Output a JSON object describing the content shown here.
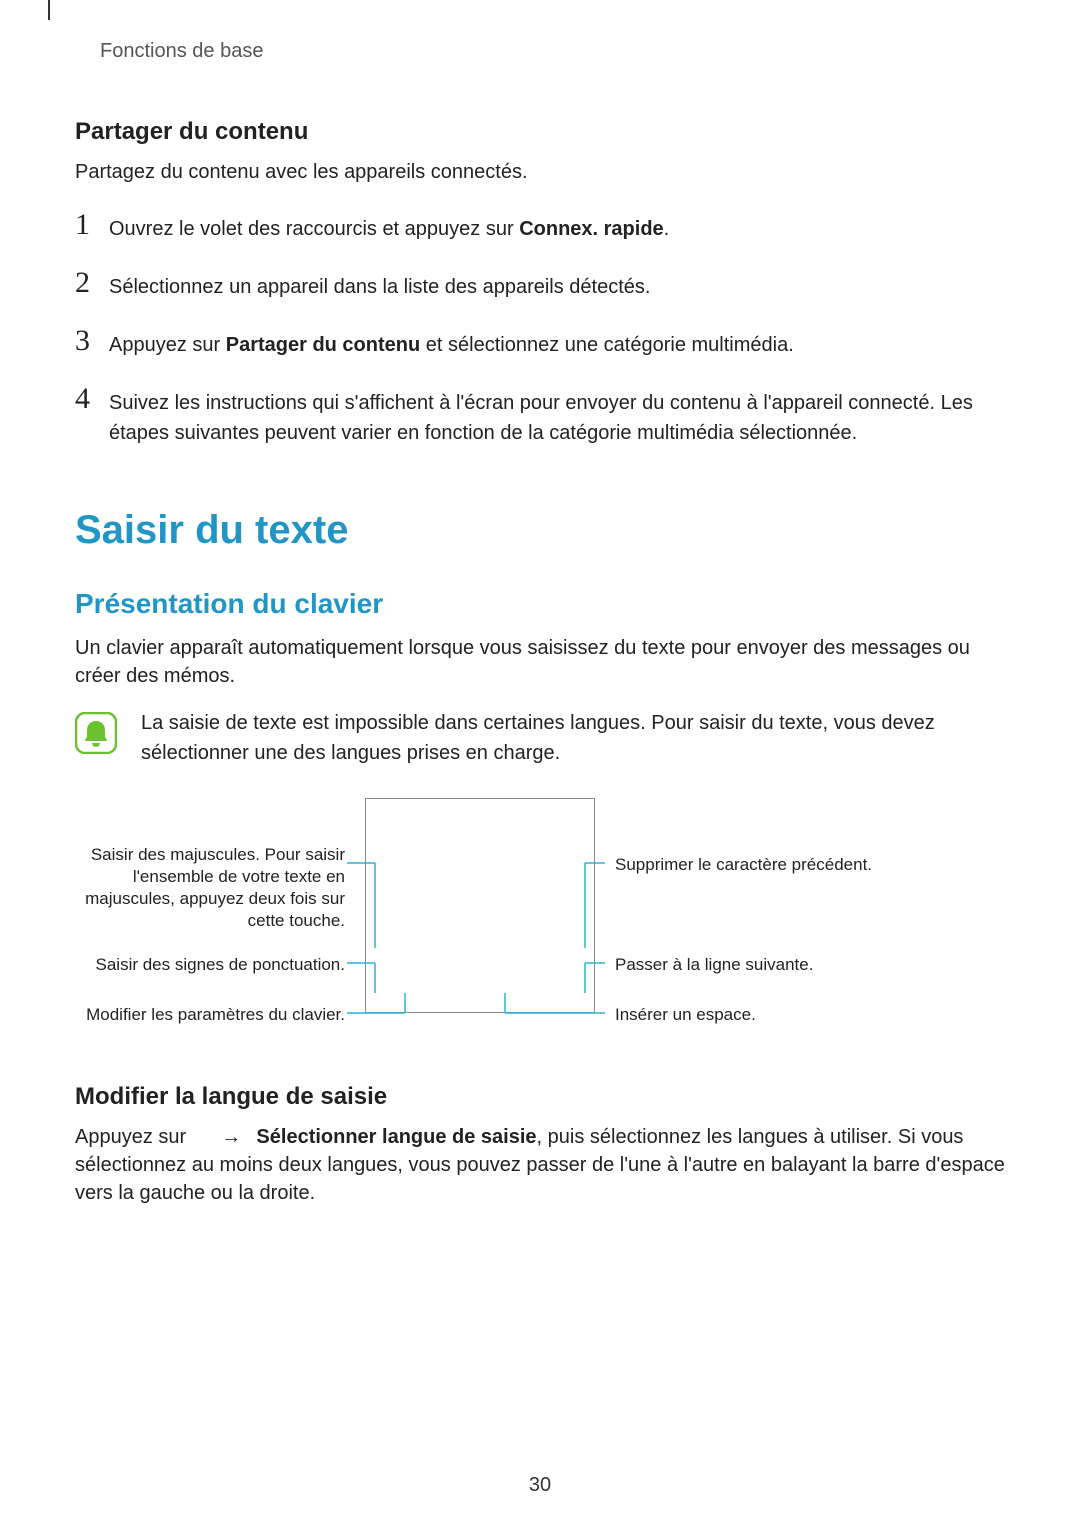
{
  "breadcrumb": "Fonctions de base",
  "section1": {
    "heading": "Partager du contenu",
    "intro": "Partagez du contenu avec les appareils connectés.",
    "steps": [
      {
        "n": "1",
        "pre": "Ouvrez le volet des raccourcis et appuyez sur ",
        "bold": "Connex. rapide",
        "post": "."
      },
      {
        "n": "2",
        "pre": "Sélectionnez un appareil dans la liste des appareils détectés.",
        "bold": "",
        "post": ""
      },
      {
        "n": "3",
        "pre": "Appuyez sur ",
        "bold": "Partager du contenu",
        "post": " et sélectionnez une catégorie multimédia."
      },
      {
        "n": "4",
        "pre": "Suivez les instructions qui s'affichent à l'écran pour envoyer du contenu à l'appareil connecté. Les étapes suivantes peuvent varier en fonction de la catégorie multimédia sélectionnée.",
        "bold": "",
        "post": ""
      }
    ]
  },
  "section2": {
    "h1": "Saisir du texte",
    "h2": "Présentation du clavier",
    "intro": "Un clavier apparaît automatiquement lorsque vous saisissez du texte pour envoyer des messages ou créer des mémos.",
    "note": "La saisie de texte est impossible dans certaines langues. Pour saisir du texte, vous devez sélectionner une des langues prises en charge.",
    "diagram": {
      "left1": "Saisir des majuscules. Pour saisir l'ensemble de votre texte en majuscules, appuyez deux fois sur cette touche.",
      "left2": "Saisir des signes de ponctuation.",
      "left3": "Modifier les paramètres du clavier.",
      "right1": "Supprimer le caractère précédent.",
      "right2": "Passer à la ligne suivante.",
      "right3": "Insérer un espace."
    },
    "h3b": "Modifier la langue de saisie",
    "para_pre": "Appuyez sur ",
    "para_arrow": "→",
    "para_bold": "Sélectionner langue de saisie",
    "para_post": ", puis sélectionnez les langues à utiliser. Si vous sélectionnez au moins deux langues, vous pouvez passer de l'une à l'autre en balayant la barre d'espace vers la gauche ou la droite."
  },
  "page_number": "30"
}
